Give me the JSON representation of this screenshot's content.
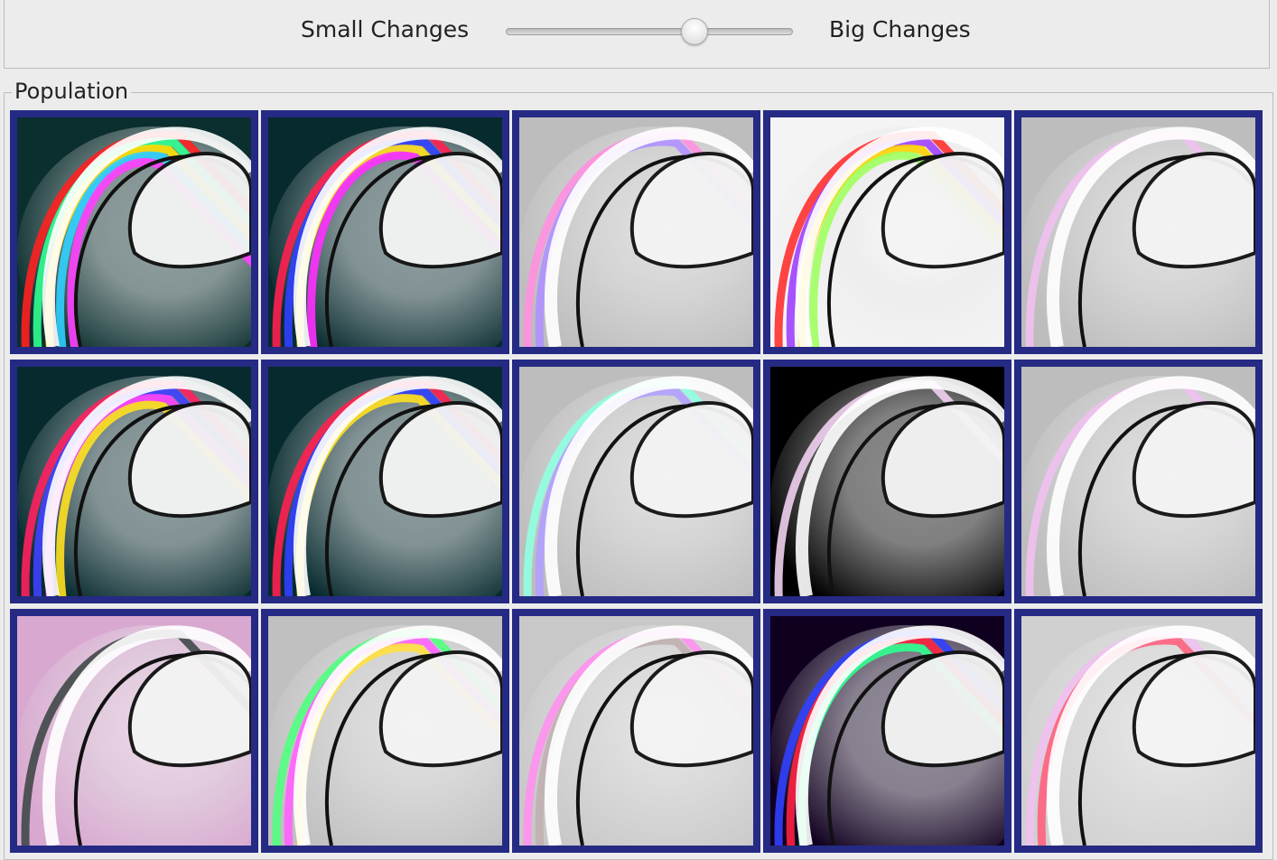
{
  "mutation": {
    "small_label": "Small Changes",
    "big_label": "Big Changes",
    "slider_value": 0.67
  },
  "population": {
    "title": "Population",
    "selection_border_color": "#252a84",
    "images": [
      {
        "name": "pattern-1",
        "bg": "#0b2e2e",
        "accent": [
          "#ff2020",
          "#30ff90",
          "#ffe000",
          "#30d0ff",
          "#ff40ff"
        ]
      },
      {
        "name": "pattern-2",
        "bg": "#062a2e",
        "accent": [
          "#ff2050",
          "#3040ff",
          "#ffe020",
          "#ff30ff"
        ]
      },
      {
        "name": "pattern-3",
        "bg": "#bdbdbd",
        "accent": [
          "#ff90e0",
          "#b090ff"
        ]
      },
      {
        "name": "pattern-4",
        "bg": "#f4f4f4",
        "accent": [
          "#ff3030",
          "#a040ff",
          "#ffd000",
          "#a0ff60"
        ]
      },
      {
        "name": "pattern-5",
        "bg": "#bdbdbd",
        "accent": [
          "#f0c0f0"
        ]
      },
      {
        "name": "pattern-6",
        "bg": "#062a2e",
        "accent": [
          "#ff2060",
          "#4040ff",
          "#ff40ff",
          "#ffe020"
        ]
      },
      {
        "name": "pattern-7",
        "bg": "#062a2e",
        "accent": [
          "#ff2050",
          "#3040ff",
          "#ffe020"
        ]
      },
      {
        "name": "pattern-8",
        "bg": "#bdbdbd",
        "accent": [
          "#90ffe0",
          "#b0a0ff"
        ]
      },
      {
        "name": "pattern-9",
        "bg": "#000000",
        "accent": [
          "#f0d0f0"
        ]
      },
      {
        "name": "pattern-10",
        "bg": "#bdbdbd",
        "accent": [
          "#f0c0f0"
        ]
      },
      {
        "name": "pattern-11",
        "bg": "#d8a8d0",
        "accent": [
          "#404848"
        ]
      },
      {
        "name": "pattern-12",
        "bg": "#c0c0c0",
        "accent": [
          "#50ff80",
          "#ff60ff",
          "#ffe040"
        ]
      },
      {
        "name": "pattern-13",
        "bg": "#c8c8c8",
        "accent": [
          "#ff90f0",
          "#c0b0b0"
        ]
      },
      {
        "name": "pattern-14",
        "bg": "#100020",
        "accent": [
          "#3040ff",
          "#ff2040",
          "#30ff90"
        ]
      },
      {
        "name": "pattern-15",
        "bg": "#d0d0d0",
        "accent": [
          "#f0c0f0",
          "#ff6080"
        ]
      }
    ]
  }
}
